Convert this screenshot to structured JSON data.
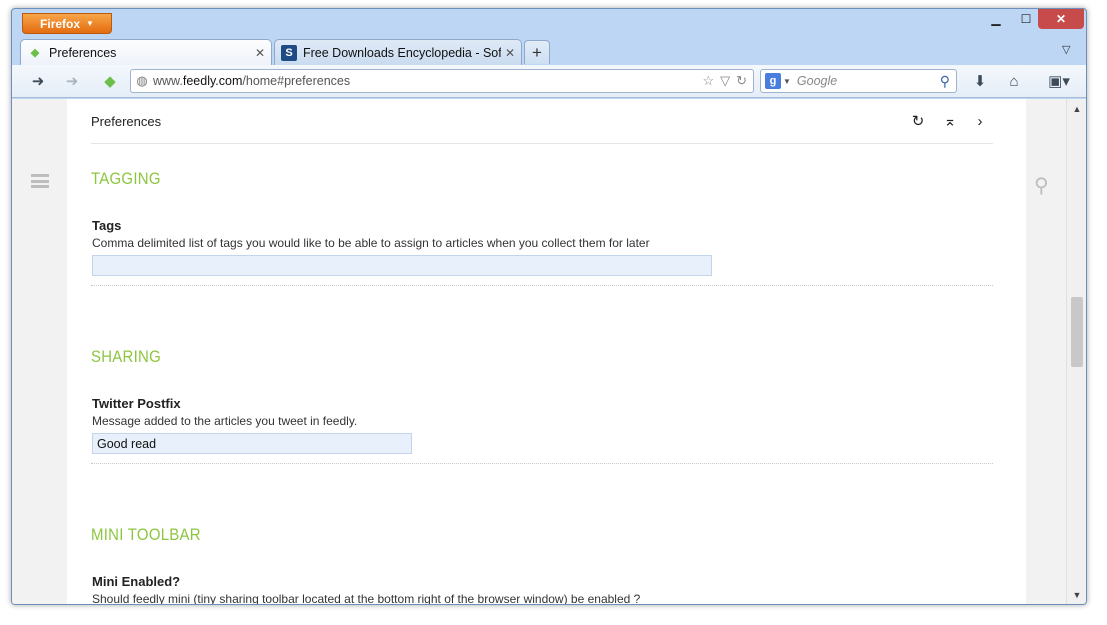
{
  "browser": {
    "menu_button": "Firefox",
    "tabs": [
      {
        "label": "Preferences",
        "favicon": "feedly-icon",
        "active": true
      },
      {
        "label": "Free Downloads Encyclopedia - Softp...",
        "favicon": "softpedia-icon",
        "active": false
      }
    ],
    "new_tab": "+",
    "url_prefix": "www.",
    "url_domain": "feedly.com",
    "url_path": "/home#preferences",
    "search_placeholder": "Google"
  },
  "page": {
    "title": "Preferences",
    "sections": [
      {
        "heading": "TAGGING",
        "field_label": "Tags",
        "field_desc": "Comma delimited list of tags you would like to be able to assign to articles when you collect them for later",
        "field_value": ""
      },
      {
        "heading": "SHARING",
        "field_label": "Twitter Postfix",
        "field_desc": "Message added to the articles you tweet in feedly.",
        "field_value": "Good read"
      },
      {
        "heading": "MINI TOOLBAR",
        "field_label": "Mini Enabled?",
        "field_desc": "Should feedly mini (tiny sharing toolbar located at the bottom right of the browser window) be enabled ?"
      }
    ]
  },
  "colors": {
    "accent_green": "#8cc63f",
    "firefox_orange": "#e46c10",
    "input_bg": "#e8f0fb"
  }
}
